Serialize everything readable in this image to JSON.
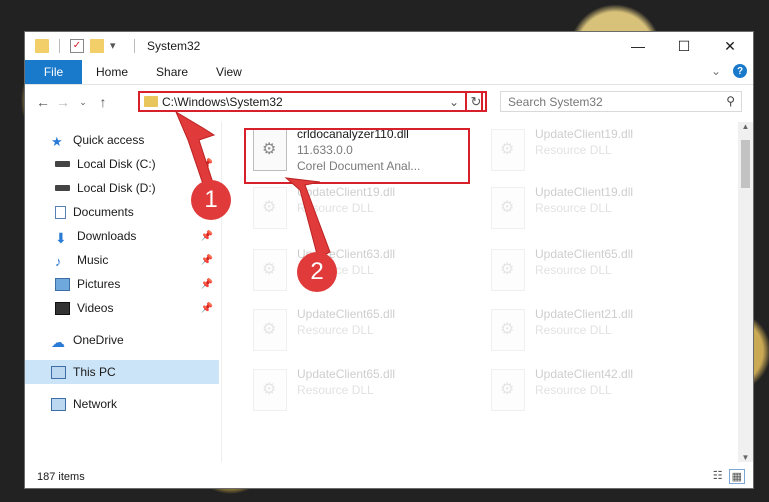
{
  "window": {
    "title": "System32",
    "buttons": {
      "minimize": "—",
      "maximize": "☐",
      "close": "✕"
    }
  },
  "ribbon": {
    "file_tab": "File",
    "tabs": [
      "Home",
      "Share",
      "View"
    ]
  },
  "address": {
    "path": "C:\\Windows\\System32",
    "search_placeholder": "Search System32"
  },
  "sidebar": {
    "quick_access": "Quick access",
    "items": [
      {
        "label": "Local Disk (C:)",
        "pinned": true
      },
      {
        "label": "Local Disk (D:)",
        "pinned": false
      },
      {
        "label": "Documents",
        "pinned": true
      },
      {
        "label": "Downloads",
        "pinned": true
      },
      {
        "label": "Music",
        "pinned": true
      },
      {
        "label": "Pictures",
        "pinned": true
      },
      {
        "label": "Videos",
        "pinned": true
      }
    ],
    "onedrive": "OneDrive",
    "this_pc": "This PC",
    "network": "Network"
  },
  "files": {
    "highlighted": {
      "name": "crldocanalyzer110.dll",
      "version": "11.633.0.0",
      "desc": "Corel Document Anal..."
    },
    "left": [
      {
        "name": "UpdateClient19.dll",
        "desc": "Resource DLL"
      },
      {
        "name": "UpdateClient63.dll",
        "desc": "Resource DLL"
      },
      {
        "name": "UpdateClient65.dll",
        "desc": "Resource DLL"
      },
      {
        "name": "UpdateClient65.dll",
        "desc": "Resource DLL"
      }
    ],
    "right": [
      {
        "name": "UpdateClient19.dll",
        "desc": "Resource DLL"
      },
      {
        "name": "UpdateClient19.dll",
        "desc": "Resource DLL"
      },
      {
        "name": "UpdateClient65.dll",
        "desc": "Resource DLL"
      },
      {
        "name": "UpdateClient21.dll",
        "desc": "Resource DLL"
      },
      {
        "name": "UpdateClient42.dll",
        "desc": "Resource DLL"
      }
    ]
  },
  "status": {
    "count": "187 items"
  },
  "annotations": {
    "step1": "1",
    "step2": "2",
    "color": "#e03a3a"
  }
}
